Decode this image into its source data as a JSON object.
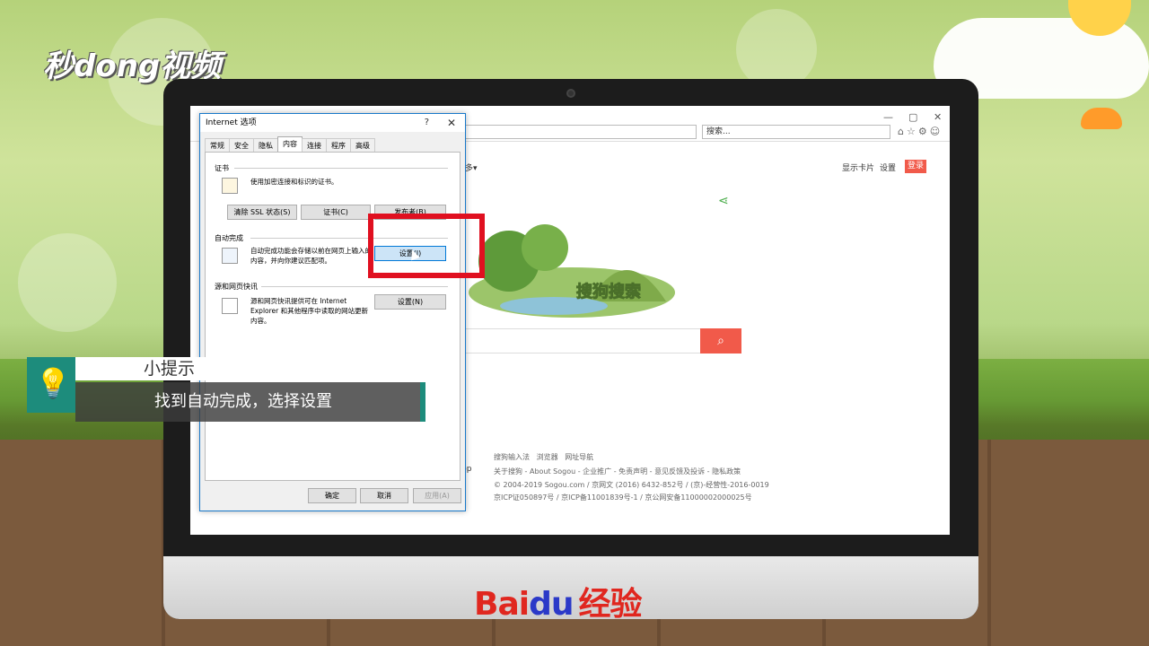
{
  "watermark": {
    "logo_text": "秒dong视频"
  },
  "brand": {
    "baidu_prefix": "Bai",
    "paw": "du",
    "jingyan": "经验"
  },
  "browser": {
    "address_text": "",
    "search_placeholder": "搜索...",
    "window_controls": [
      "—",
      "▢",
      "✕"
    ],
    "toolbar_icons": [
      "home-icon",
      "star-icon",
      "gear-icon",
      "smiley-icon"
    ]
  },
  "sogou": {
    "more_label": "多▾",
    "links": [
      "显示卡片",
      "设置"
    ],
    "login_label": "登录",
    "logo_text": "搜狗搜索",
    "search_icon": "search-icon",
    "footer_nav": [
      "搜狗输入法",
      "浏览器",
      "网址导航"
    ],
    "footer_links": "关于搜狗 - About Sogou - 企业推广 - 免责声明 - 意见反馈及投诉 - 隐私政策",
    "copyright": "© 2004-2019 Sogou.com / 京网文 (2016) 6432-852号 / (京)-经营性-2016-0019",
    "icp": "京ICP证050897号 / 京ICP备11001839号-1 / 京公网安备11000002000025号",
    "app_fragment": "pp"
  },
  "dialog": {
    "title": "Internet 选项",
    "help": "?",
    "close": "✕",
    "tabs": [
      "常规",
      "安全",
      "隐私",
      "内容",
      "连接",
      "程序",
      "高级"
    ],
    "active_tab": "内容",
    "cert": {
      "heading": "证书",
      "text": "使用加密连接和标识的证书。",
      "buttons": [
        "清除 SSL 状态(S)",
        "证书(C)",
        "发布者(B)"
      ]
    },
    "autocomplete": {
      "heading": "自动完成",
      "text1": "自动完成功能会存储以前在网页上输入的",
      "text2": "内容，并向你建议匹配项。",
      "button": "设置(I)"
    },
    "feeds": {
      "heading": "源和网页快讯",
      "text1": "源和网页快讯提供可在 Internet",
      "text2": "Explorer 和其他程序中读取的网站更新",
      "text3": "内容。",
      "button": "设置(N)"
    },
    "footer_buttons": [
      "确定",
      "取消",
      "应用(A)"
    ]
  },
  "tip": {
    "title": "小提示",
    "body": "找到自动完成，选择设置"
  },
  "colors": {
    "accent_red": "#e01020",
    "tip_teal": "#1d8c7c",
    "sogou_red": "#f15a4a"
  }
}
